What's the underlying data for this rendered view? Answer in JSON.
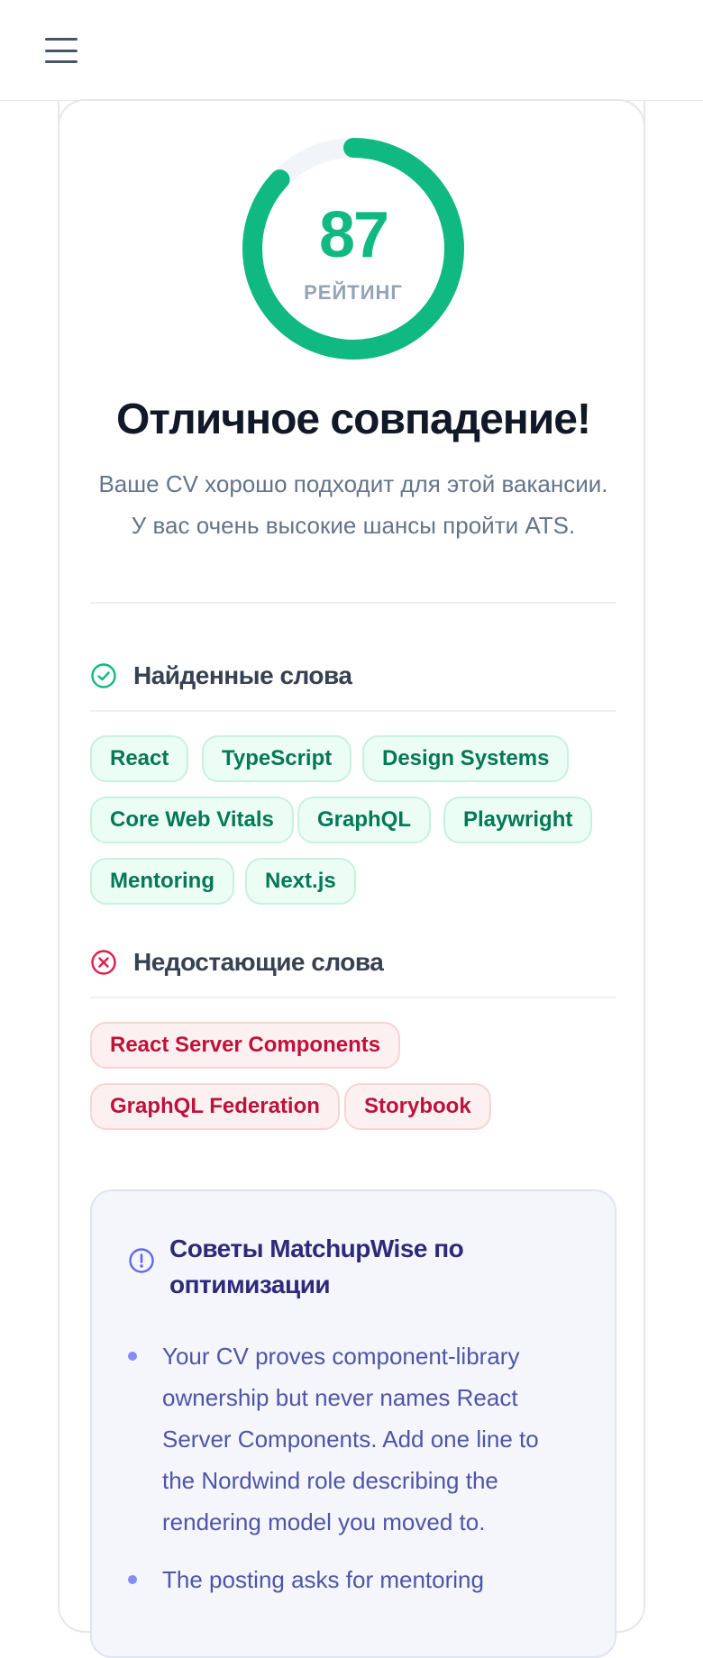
{
  "app": {
    "menu_icon": "hamburger-menu-icon"
  },
  "score": {
    "value": "87",
    "label": "РЕЙТИНГ",
    "percent": 87,
    "color": "#10b981",
    "track_color": "#f1f5f9"
  },
  "summary": {
    "headline": "Отличное совпадение!",
    "line1": "Ваше CV хорошо подходит для этой вакансии.",
    "line2": "У вас очень высокие шансы пройти ATS."
  },
  "found": {
    "title": "Найденные слова",
    "icon": "check-circle-icon",
    "keywords": [
      "React",
      "TypeScript",
      "Design Systems",
      "Core Web Vitals",
      "GraphQL",
      "Playwright",
      "Mentoring",
      "Next.js"
    ]
  },
  "missing": {
    "title": "Недостающие слова",
    "icon": "x-circle-icon",
    "keywords": [
      "React Server Components",
      "GraphQL Federation",
      "Storybook"
    ]
  },
  "tips": {
    "icon": "info-circle-icon",
    "title_line1": "Советы MatchupWise по",
    "title_line2": "оптимизации",
    "items": [
      {
        "lines": [
          "Your CV proves component-library",
          "ownership but never names React",
          "Server Components. Add one line to",
          "the Nordwind role describing the",
          "rendering model you moved to."
        ]
      },
      {
        "lines": [
          "The posting asks for mentoring"
        ]
      }
    ]
  },
  "colors": {
    "found_text": "#047857",
    "missing_text": "#be123c",
    "tips_accent": "#818cf8"
  }
}
